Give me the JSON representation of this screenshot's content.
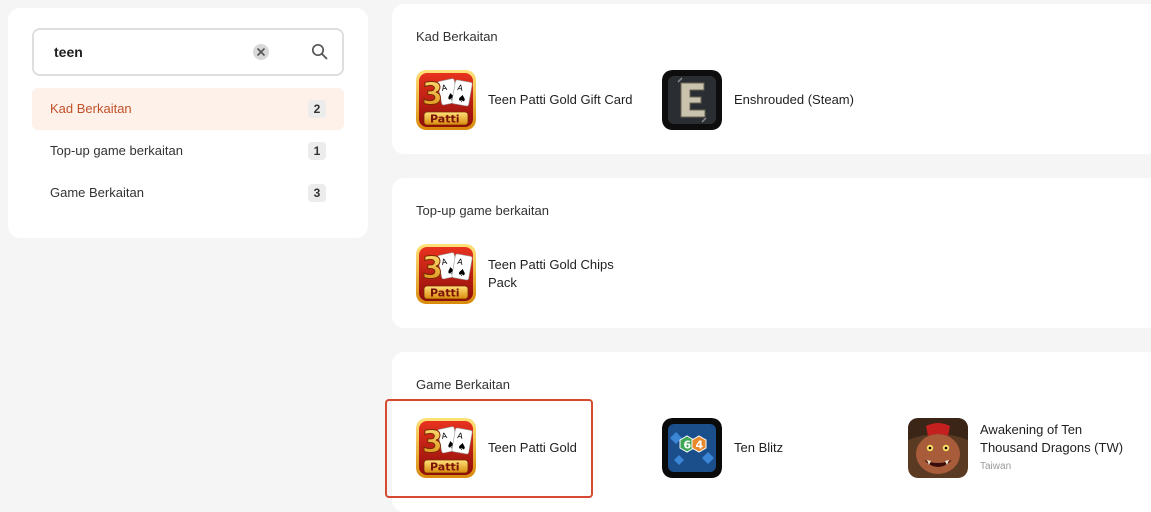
{
  "search": {
    "value": "teen"
  },
  "filters": [
    {
      "label": "Kad Berkaitan",
      "count": "2",
      "active": true
    },
    {
      "label": "Top-up game berkaitan",
      "count": "1",
      "active": false
    },
    {
      "label": "Game Berkaitan",
      "count": "3",
      "active": false
    }
  ],
  "sections": [
    {
      "title": "Kad Berkaitan",
      "items": [
        {
          "name": "Teen Patti Gold Gift Card",
          "icon": "teen-patti-logo"
        },
        {
          "name": "Enshrouded (Steam)",
          "icon": "enshrouded-logo"
        }
      ]
    },
    {
      "title": "Top-up game berkaitan",
      "items": [
        {
          "name": "Teen Patti Gold Chips Pack",
          "icon": "teen-patti-logo"
        }
      ]
    },
    {
      "title": "Game Berkaitan",
      "items": [
        {
          "name": "Teen Patti Gold",
          "icon": "teen-patti-logo"
        },
        {
          "name": "Ten Blitz",
          "icon": "ten-blitz-logo"
        },
        {
          "name": "Awakening of Ten Thousand Dragons (TW)",
          "sub": "Taiwan",
          "icon": "dragon-creature-logo"
        }
      ]
    }
  ],
  "colors": {
    "accent": "#c3512a",
    "active_bg": "#fdf1ea",
    "highlight": "#d64a32"
  }
}
